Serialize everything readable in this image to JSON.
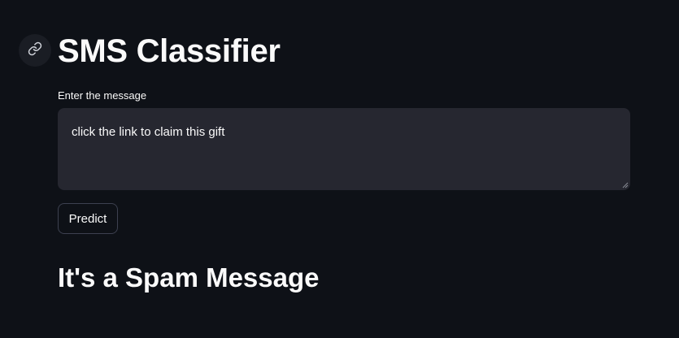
{
  "header": {
    "title": "SMS Classifier",
    "anchor_icon": "link-icon"
  },
  "form": {
    "label": "Enter the message",
    "message_value": "click the link to claim this gift",
    "predict_label": "Predict"
  },
  "result": {
    "text": "It's a Spam Message"
  },
  "colors": {
    "background": "#0e1117",
    "input_background": "#262730",
    "text": "#fafafa",
    "button_border": "#3d4150"
  }
}
